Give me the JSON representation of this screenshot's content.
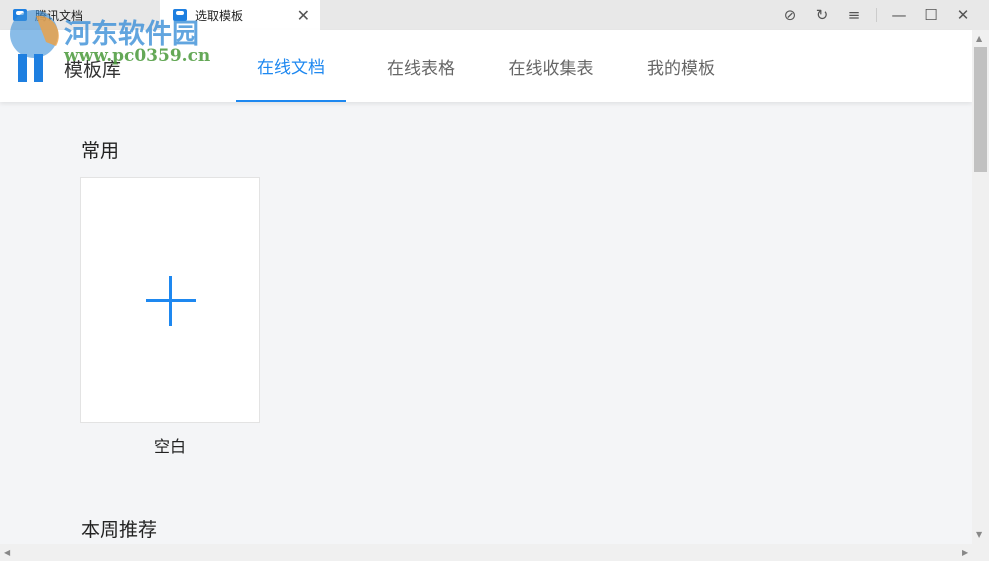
{
  "window_tabs": [
    {
      "label": "腾讯文档"
    },
    {
      "label": "选取模板"
    }
  ],
  "window_controls": {
    "close": "×",
    "minimize": "—",
    "maximize": "☐",
    "menu": "☰"
  },
  "header": {
    "brand": "模板库",
    "nav": [
      {
        "label": "在线文档",
        "active": true
      },
      {
        "label": "在线表格"
      },
      {
        "label": "在线收集表"
      },
      {
        "label": "我的模板"
      }
    ]
  },
  "sections": {
    "common": "常用",
    "weekly": "本周推荐"
  },
  "blank_card": {
    "label": "空白"
  },
  "watermark": {
    "title": "河东软件园",
    "url": "www.pc0359.cn"
  },
  "accent": "#1e88f0"
}
